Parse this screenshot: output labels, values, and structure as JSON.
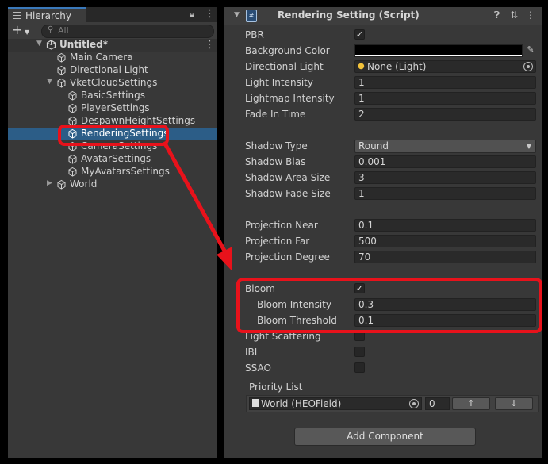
{
  "hierarchy": {
    "tab_label": "Hierarchy",
    "search_placeholder": "All",
    "scene_name": "Untitled*",
    "items": [
      {
        "label": "Main Camera"
      },
      {
        "label": "Directional Light"
      },
      {
        "label": "VketCloudSettings"
      },
      {
        "label": "BasicSettings"
      },
      {
        "label": "PlayerSettings"
      },
      {
        "label": "DespawnHeightSettings"
      },
      {
        "label": "RenderingSettings"
      },
      {
        "label": "CameraSettings"
      },
      {
        "label": "AvatarSettings"
      },
      {
        "label": "MyAvatarsSettings"
      },
      {
        "label": "World"
      }
    ],
    "selected": "RenderingSettings"
  },
  "inspector": {
    "component_title": "Rendering Setting (Script)",
    "props": {
      "pbr": {
        "label": "PBR",
        "checked": true
      },
      "background_color": {
        "label": "Background Color",
        "value": "#000000"
      },
      "directional_light": {
        "label": "Directional Light",
        "value": "None (Light)"
      },
      "light_intensity": {
        "label": "Light Intensity",
        "value": "1"
      },
      "lightmap_intensity": {
        "label": "Lightmap Intensity",
        "value": "1"
      },
      "fade_in_time": {
        "label": "Fade In Time",
        "value": "2"
      },
      "shadow_type": {
        "label": "Shadow Type",
        "value": "Round"
      },
      "shadow_bias": {
        "label": "Shadow Bias",
        "value": "0.001"
      },
      "shadow_area_size": {
        "label": "Shadow Area Size",
        "value": "3"
      },
      "shadow_fade_size": {
        "label": "Shadow Fade Size",
        "value": "1"
      },
      "projection_near": {
        "label": "Projection Near",
        "value": "0.1"
      },
      "projection_far": {
        "label": "Projection Far",
        "value": "500"
      },
      "projection_degree": {
        "label": "Projection Degree",
        "value": "70"
      },
      "bloom": {
        "label": "Bloom",
        "checked": true
      },
      "bloom_intensity": {
        "label": "Bloom Intensity",
        "value": "0.3"
      },
      "bloom_threshold": {
        "label": "Bloom Threshold",
        "value": "0.1"
      },
      "light_scattering": {
        "label": "Light Scattering",
        "checked": false
      },
      "ibl": {
        "label": "IBL",
        "checked": false
      },
      "ssao": {
        "label": "SSAO",
        "checked": false
      }
    },
    "priority_list": {
      "label": "Priority List",
      "object": "World (HEOField)",
      "number": "0",
      "up": "↑",
      "down": "↓"
    },
    "add_component": "Add Component"
  },
  "colors": {
    "annotation_red": "#e8121b",
    "selection_blue": "#2c5d87"
  }
}
